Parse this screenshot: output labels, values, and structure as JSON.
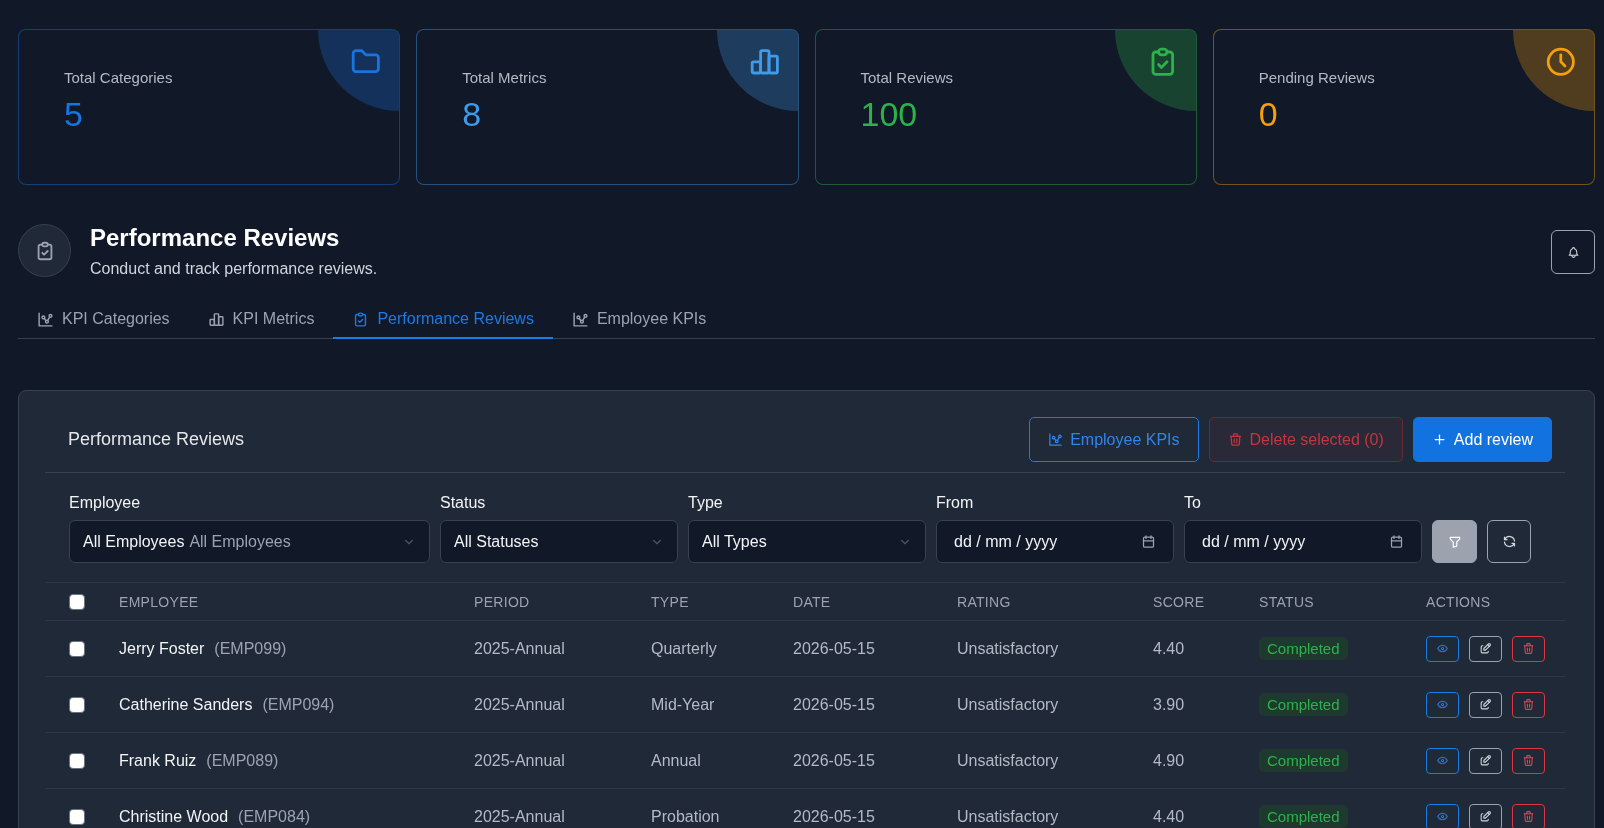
{
  "stats": [
    {
      "label": "Total Categories",
      "value": "5",
      "color": "#1874e0"
    },
    {
      "label": "Total Metrics",
      "value": "8",
      "color": "#3f9ae8"
    },
    {
      "label": "Total Reviews",
      "value": "100",
      "color": "#2db24a"
    },
    {
      "label": "Pending Reviews",
      "value": "0",
      "color": "#f59f0a"
    }
  ],
  "header": {
    "title": "Performance Reviews",
    "subtitle": "Conduct and track performance reviews."
  },
  "tabs": [
    {
      "label": "KPI Categories",
      "selected": false
    },
    {
      "label": "KPI Metrics",
      "selected": false
    },
    {
      "label": "Performance Reviews",
      "selected": true
    },
    {
      "label": "Employee KPIs",
      "selected": false
    }
  ],
  "panel": {
    "title": "Performance Reviews",
    "buttons": [
      {
        "label": "Employee KPIs",
        "kind": "outline",
        "disabled": false
      },
      {
        "label": "Delete selected (0)",
        "kind": "danger",
        "disabled": true
      },
      {
        "label": "Add review",
        "kind": "primary",
        "disabled": false
      }
    ],
    "filters": [
      {
        "label": "Employee",
        "kind": "select",
        "value": "All Employees",
        "placeholder": "All Employees"
      },
      {
        "label": "Status",
        "kind": "select",
        "value": "All Statuses"
      },
      {
        "label": "Type",
        "kind": "select",
        "value": "All Types"
      },
      {
        "label": "From",
        "kind": "date",
        "placeholder": "dd / mm / yyyy"
      },
      {
        "label": "To",
        "kind": "date",
        "placeholder": "dd / mm / yyyy"
      }
    ],
    "table": {
      "all_checked": false,
      "columns": [
        "EMPLOYEE",
        "PERIOD",
        "TYPE",
        "DATE",
        "RATING",
        "SCORE",
        "STATUS",
        "ACTIONS"
      ],
      "rows": [
        {
          "checked": false,
          "employee": "Jerry Foster",
          "employee_id": "(EMP099)",
          "period": "2025-Annual",
          "type": "Quarterly",
          "date": "2026-05-15",
          "rating": "Unsatisfactory",
          "score": "4.40",
          "status": "Completed"
        },
        {
          "checked": false,
          "employee": "Catherine Sanders",
          "employee_id": "(EMP094)",
          "period": "2025-Annual",
          "type": "Mid-Year",
          "date": "2026-05-15",
          "rating": "Unsatisfactory",
          "score": "3.90",
          "status": "Completed"
        },
        {
          "checked": false,
          "employee": "Frank Ruiz",
          "employee_id": "(EMP089)",
          "period": "2025-Annual",
          "type": "Annual",
          "date": "2026-05-15",
          "rating": "Unsatisfactory",
          "score": "4.90",
          "status": "Completed"
        },
        {
          "checked": false,
          "employee": "Christine Wood",
          "employee_id": "(EMP084)",
          "period": "2025-Annual",
          "type": "Probation",
          "date": "2026-05-15",
          "rating": "Unsatisfactory",
          "score": "4.40",
          "status": "Completed"
        }
      ]
    }
  }
}
